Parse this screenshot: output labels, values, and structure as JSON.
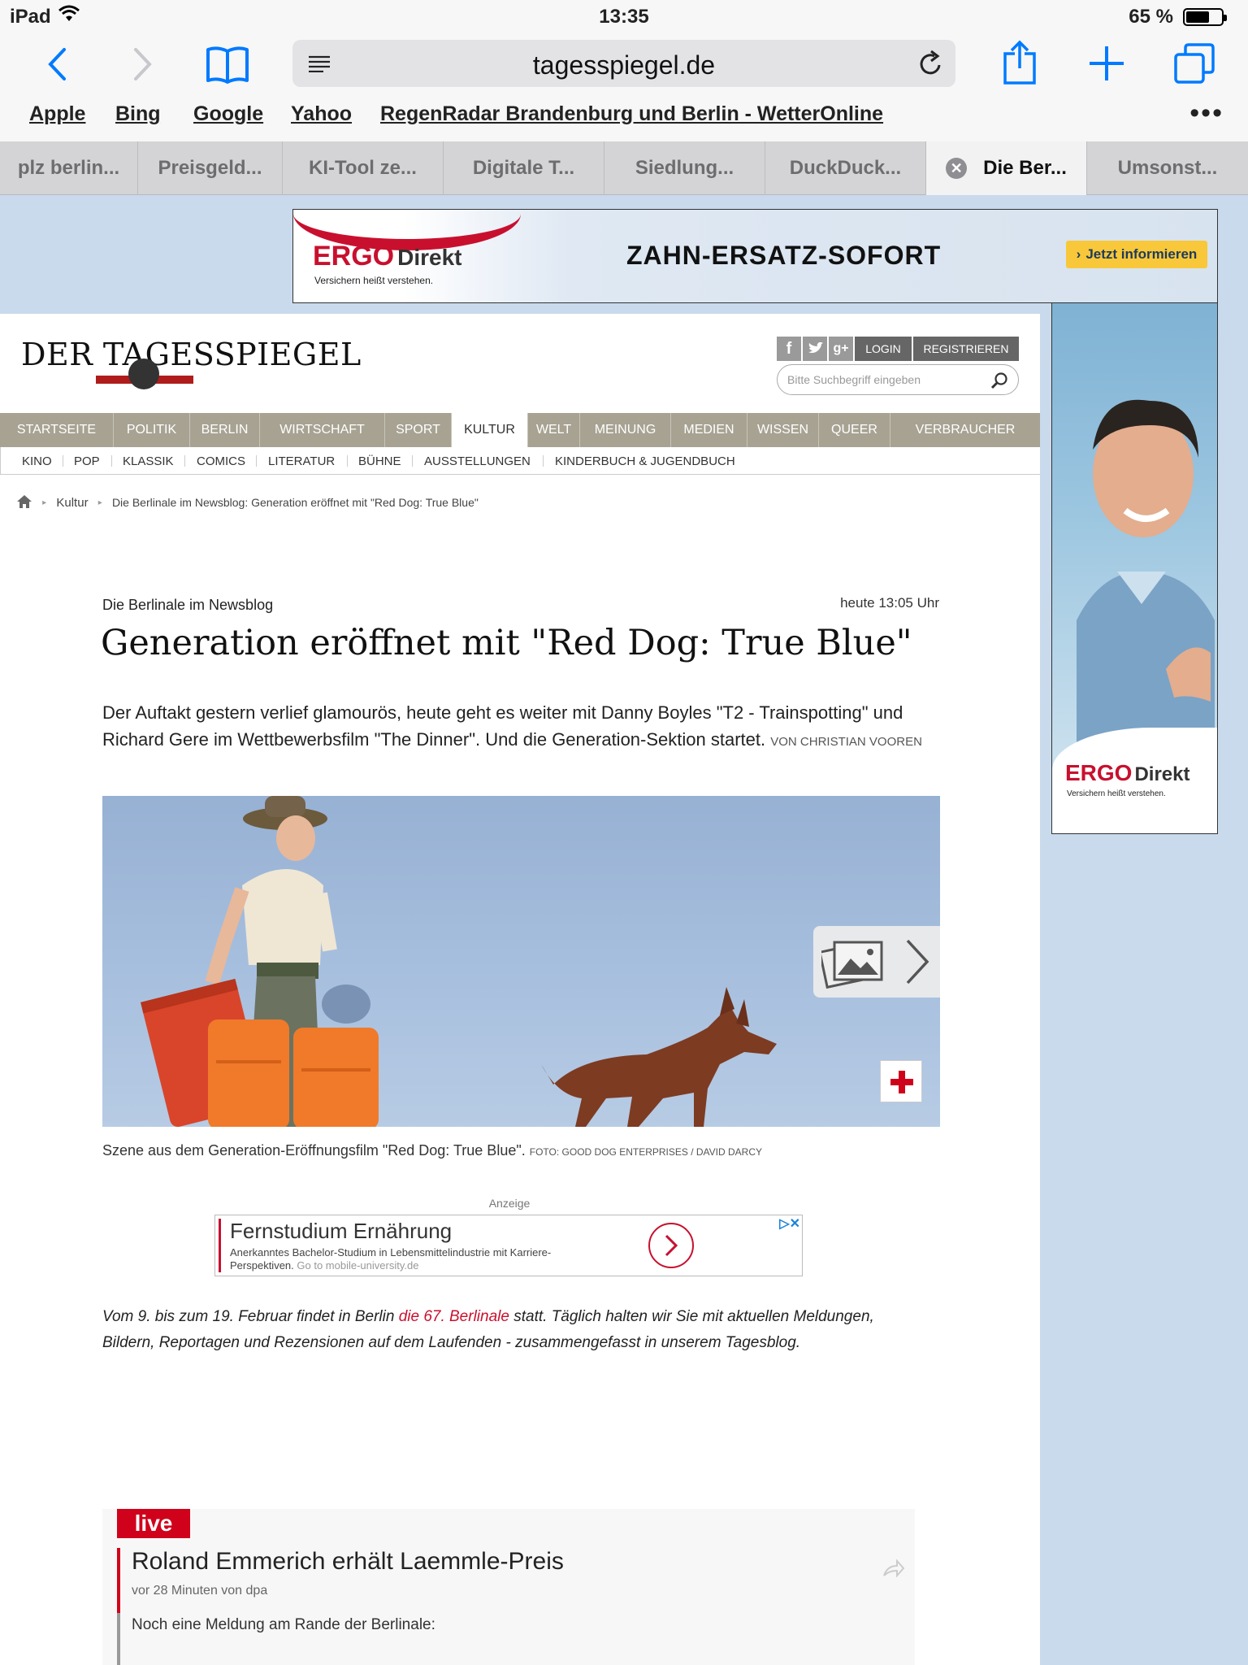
{
  "status": {
    "device": "iPad",
    "time": "13:35",
    "battery": "65 %",
    "battery_level": 0.65
  },
  "toolbar": {
    "url": "tagesspiegel.de"
  },
  "favorites": [
    "Apple",
    "Bing",
    "Google",
    "Yahoo",
    "RegenRadar Brandenburg und Berlin - WetterOnline"
  ],
  "tabs": [
    {
      "label": "plz berlin..."
    },
    {
      "label": "Preisgeld..."
    },
    {
      "label": "KI-Tool ze..."
    },
    {
      "label": "Digitale T..."
    },
    {
      "label": "Siedlung..."
    },
    {
      "label": "DuckDuck..."
    },
    {
      "label": "Die Ber...",
      "active": true
    },
    {
      "label": "Umsonst..."
    }
  ],
  "ad_top": {
    "brand_ergo": "ERGO",
    "brand_direkt": "Direkt",
    "tagline": "Versichern heißt verstehen.",
    "headline": "ZAHN-ERSATZ-SOFORT",
    "cta": "Jetzt informieren"
  },
  "ad_side": {
    "brand_ergo": "ERGO",
    "brand_direkt": "Direkt",
    "tagline": "Versichern heißt verstehen."
  },
  "site": {
    "masthead": "DER TAGESSPIEGEL",
    "login": "LOGIN",
    "register": "REGISTRIEREN",
    "search_placeholder": "Bitte Suchbegriff eingeben"
  },
  "nav": [
    "STARTSEITE",
    "POLITIK",
    "BERLIN",
    "WIRTSCHAFT",
    "SPORT",
    "KULTUR",
    "WELT",
    "MEINUNG",
    "MEDIEN",
    "WISSEN",
    "QUEER",
    "VERBRAUCHER"
  ],
  "subnav": [
    "KINO",
    "POP",
    "KLASSIK",
    "COMICS",
    "LITERATUR",
    "BÜHNE",
    "AUSSTELLUNGEN",
    "KINDERBUCH & JUGENDBUCH"
  ],
  "breadcrumb": {
    "section": "Kultur",
    "current": "Die Berlinale im Newsblog: Generation eröffnet mit \"Red Dog: True Blue\""
  },
  "article": {
    "kicker": "Die Berlinale im Newsblog",
    "date": "heute 13:05 Uhr",
    "title": "Generation eröffnet mit \"Red Dog: True Blue\"",
    "lead": "Der Auftakt gestern verlief glamourös, heute geht es weiter mit Danny Boyles \"T2 - Trainspotting\" und Richard Gere im Wettbewerbsfilm \"The Dinner\". Und die Generation-Sektion startet.",
    "author": "VON CHRISTIAN VOOREN",
    "caption": "Szene aus dem Generation-Eröffnungsfilm \"Red Dog: True Blue\".",
    "credit": "FOTO: GOOD DOG ENTERPRISES / DAVID DARCY",
    "intro_before": "Vom 9. bis zum 19. Februar findet in Berlin ",
    "intro_link": "die 67. Berlinale",
    "intro_after": " statt. Täglich halten wir Sie mit aktuellen Meldungen, Bildern, Reportagen und Rezensionen auf dem Laufenden - zusammengefasst in unserem Tagesblog."
  },
  "ad_inline": {
    "label": "Anzeige",
    "headline": "Fernstudium Ernährung",
    "desc": "Anerkanntes Bachelor-Studium in Lebensmittelindustrie mit Karriere-Perspektiven.",
    "source": "Go to mobile-university.de"
  },
  "live": {
    "tag": "live",
    "title": "Roland Emmerich erhält Laemmle-Preis",
    "meta": "vor 28 Minuten von dpa",
    "text": "Noch eine Meldung am Rande der Berlinale:"
  },
  "colors": {
    "accent": "#007aff",
    "brand_red": "#c8102e",
    "nav_bg": "#a7a292",
    "live_red": "#d0021b"
  }
}
